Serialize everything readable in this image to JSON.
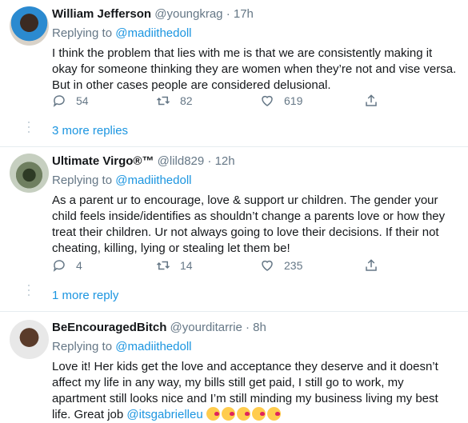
{
  "tweets": [
    {
      "name": "William Jefferson",
      "handle": "@youngkrag",
      "dot": "·",
      "time": "17h",
      "replying_prefix": "Replying to ",
      "replying_to": "@madiithedoll",
      "text": "I think the problem that lies with me is that we are consistently making it\nokay for someone thinking they are women when they’re not and vise versa.\nBut in other cases people are considered delusional.",
      "replies": "54",
      "retweets": "82",
      "likes": "619",
      "more_replies": "3 more replies"
    },
    {
      "name": "Ultimate Virgo®™",
      "handle": "@lild829",
      "dot": "·",
      "time": "12h",
      "replying_prefix": "Replying to ",
      "replying_to": "@madiithedoll",
      "text": "As a parent ur to encourage, love & support ur children. The gender your\nchild feels inside/identifies as shouldn’t change a parents love or how they\ntreat their children. Ur not always going to love their decisions. If their not\ncheating, killing, lying or stealing let them be!",
      "replies": "4",
      "retweets": "14",
      "likes": "235",
      "more_replies": "1 more reply"
    },
    {
      "name": "BeEncouragedBitch",
      "handle": "@yourditarrie",
      "dot": "·",
      "time": "8h",
      "replying_prefix": "Replying to ",
      "replying_to": "@madiithedoll",
      "text": "Love it! Her kids get the love and acceptance they deserve and it doesn’t\naffect my life in any way, my bills still get paid, I still go to work, my\napartment still looks nice and I’m still minding my business living my best\nlife. Great job ",
      "text_mention": "@itsgabrielleu",
      "emoji_names": [
        "face-blowing-kiss",
        "face-blowing-kiss",
        "face-blowing-kiss",
        "face-blowing-kiss",
        "face-blowing-kiss"
      ]
    }
  ],
  "colors": {
    "link": "#1b95e0",
    "secondary_text": "#657786",
    "primary_text": "#14171a",
    "divider": "#e6ecf0"
  }
}
